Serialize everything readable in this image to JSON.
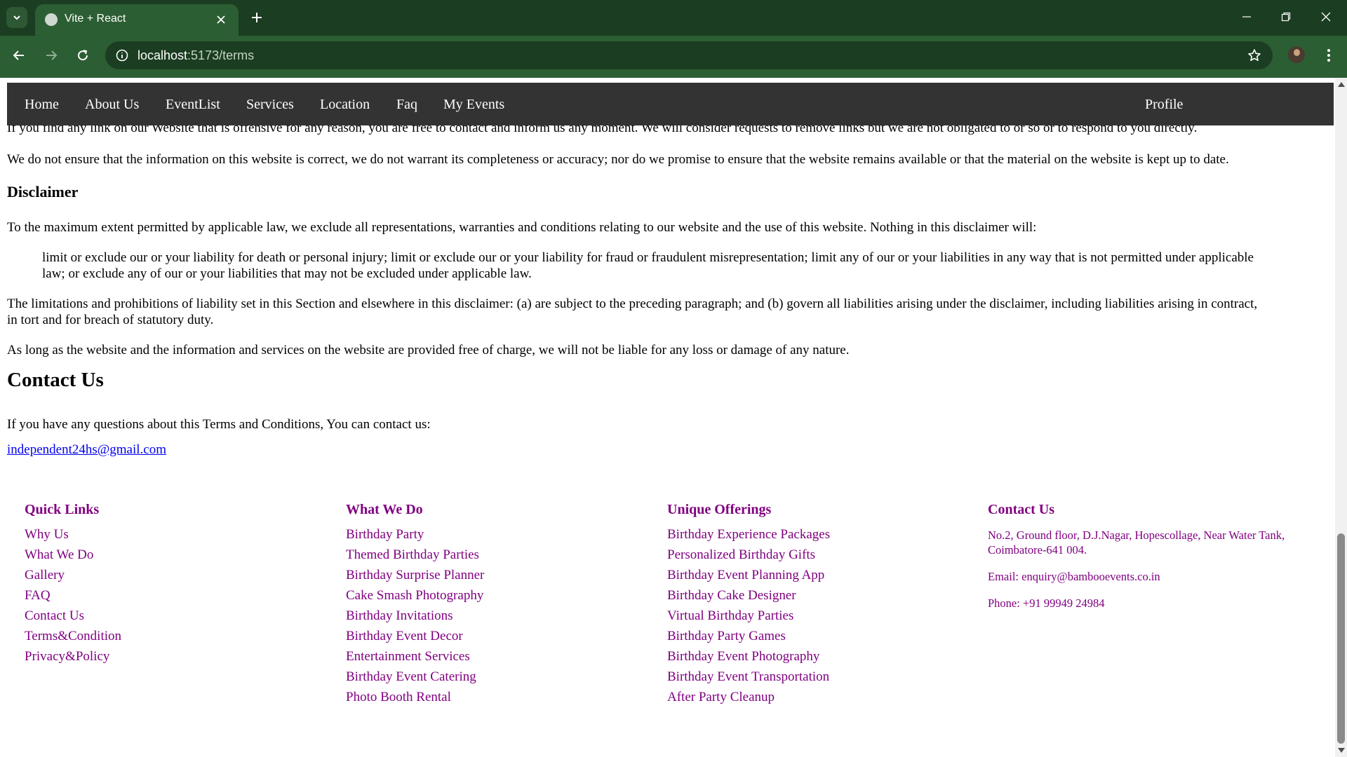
{
  "browser": {
    "tab_title": "Vite + React",
    "url_host": "localhost",
    "url_path": ":5173/terms"
  },
  "navbar": {
    "items": [
      "Home",
      "About Us",
      "EventList",
      "Services",
      "Location",
      "Faq",
      "My Events"
    ],
    "profile": "Profile"
  },
  "content": {
    "cut_paragraph": "If you find any link on our Website that is offensive for any reason, you are free to contact and inform us any moment. We will consider requests to remove links but we are not obligated to or so or to respond to you directly.",
    "accuracy_paragraph": "We do not ensure that the information on this website is correct, we do not warrant its completeness or accuracy; nor do we promise to ensure that the website remains available or that the material on the website is kept up to date.",
    "disclaimer_heading": "Disclaimer",
    "disclaimer_intro": "To the maximum extent permitted by applicable law, we exclude all representations, warranties and conditions relating to our website and the use of this website. Nothing in this disclaimer will:",
    "disclaimer_quote_line1": "limit or exclude our or your liability for death or personal injury; limit or exclude our or your liability for fraud or fraudulent misrepresentation; limit any of our or your liabilities in any way that is not permitted under applicable",
    "disclaimer_quote_line2": "law; or exclude any of our or your liabilities that may not be excluded under applicable law.",
    "limitations_line1": "The limitations and prohibitions of liability set in this Section and elsewhere in this disclaimer: (a) are subject to the preceding paragraph; and (b) govern all liabilities arising under the disclaimer, including liabilities arising in contract,",
    "limitations_line2": "in tort and for breach of statutory duty.",
    "free_paragraph": "As long as the website and the information and services on the website are provided free of charge, we will not be liable for any loss or damage of any nature.",
    "contact_heading": "Contact Us",
    "contact_text": "If you have any questions about this Terms and Conditions, You can contact us:",
    "contact_email": "independent24hs@gmail.com"
  },
  "footer": {
    "quick_links": {
      "title": "Quick Links",
      "items": [
        "Why Us",
        "What We Do",
        "Gallery",
        "FAQ",
        "Contact Us",
        "Terms&Condition",
        "Privacy&Policy"
      ]
    },
    "what_we_do": {
      "title": "What We Do",
      "items": [
        "Birthday Party",
        "Themed Birthday Parties",
        "Birthday Surprise Planner",
        "Cake Smash Photography",
        "Birthday Invitations",
        "Birthday Event Decor",
        "Entertainment Services",
        "Birthday Event Catering",
        "Photo Booth Rental"
      ]
    },
    "unique_offerings": {
      "title": "Unique Offerings",
      "items": [
        "Birthday Experience Packages",
        "Personalized Birthday Gifts",
        "Birthday Event Planning App",
        "Birthday Cake Designer",
        "Virtual Birthday Parties",
        "Birthday Party Games",
        "Birthday Event Photography",
        "Birthday Event Transportation",
        "After Party Cleanup"
      ]
    },
    "contact": {
      "title": "Contact Us",
      "address": "No.2, Ground floor, D.J.Nagar, Hopescollage, Near Water Tank, Coimbatore-641 004.",
      "email": "Email: enquiry@bambooevents.co.in",
      "phone": "Phone: +91 99949 24984"
    }
  },
  "colors": {
    "tab_bar": "#1b3d21",
    "toolbar": "#2c5e33",
    "navbar": "#333333",
    "footer_text": "#800080",
    "link": "#0000ee"
  }
}
